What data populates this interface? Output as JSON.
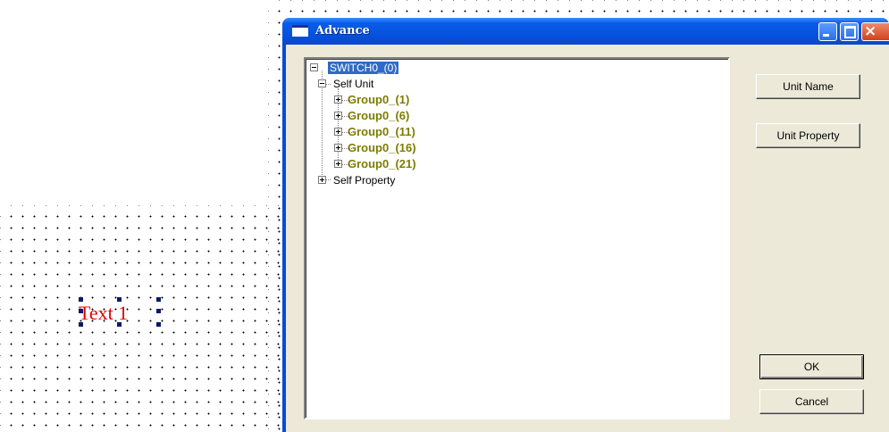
{
  "canvas": {
    "text_object_label": "Text 1",
    "text_color": "#e00000"
  },
  "window": {
    "title": "Advance",
    "title_bar_color": "#0a49d8",
    "buttons": {
      "minimize": "minimize",
      "maximize": "maximize",
      "close": "×"
    }
  },
  "tree": {
    "root": {
      "label": "SWITCH0_(0)",
      "expanded": true,
      "children": [
        {
          "label": "Self Unit",
          "expanded": true,
          "children": [
            {
              "label": "Group0_(1)",
              "expanded": false
            },
            {
              "label": "Group0_(6)",
              "expanded": false
            },
            {
              "label": "Group0_(11)",
              "expanded": false
            },
            {
              "label": "Group0_(16)",
              "expanded": false
            },
            {
              "label": "Group0_(21)",
              "expanded": false
            }
          ]
        },
        {
          "label": "Self Property",
          "expanded": false
        }
      ]
    },
    "selected_color": "#316ac5",
    "group_color": "#7d7d00"
  },
  "actions": {
    "unit_name": "Unit Name",
    "unit_property": "Unit Property",
    "ok": "OK",
    "cancel": "Cancel"
  }
}
